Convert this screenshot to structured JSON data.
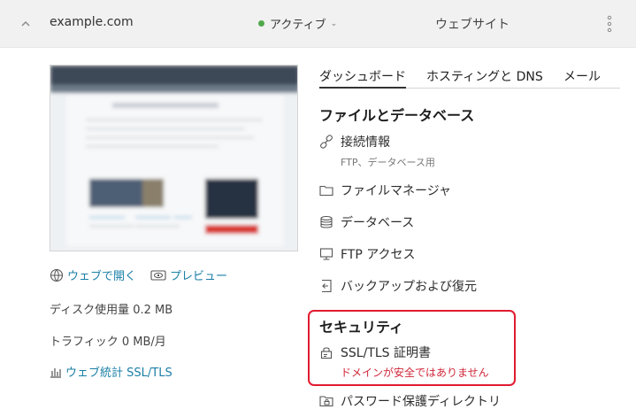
{
  "header": {
    "domain": "example.com",
    "status": "アクティブ",
    "site_label": "ウェブサイト"
  },
  "left": {
    "open_web": "ウェブで開く",
    "preview": "プレビュー",
    "disk_usage": "ディスク使用量 0.2 MB",
    "traffic": "トラフィック 0 MB/月",
    "web_stats": "ウェブ統計 SSL/TLS"
  },
  "tabs": [
    "ダッシュボード",
    "ホスティングと DNS",
    "メール"
  ],
  "files_db": {
    "title": "ファイルとデータベース",
    "connection": "接続情報",
    "connection_sub": "FTP、データベース用",
    "file_manager": "ファイルマネージャ",
    "database": "データベース",
    "ftp": "FTP アクセス",
    "backup": "バックアップおよび復元"
  },
  "security": {
    "title": "セキュリティ",
    "ssl": "SSL/TLS 証明書",
    "warning": "ドメインが安全ではありません",
    "password_dirs": "パスワード保護ディレクトリ"
  },
  "colors": {
    "link": "#1a7fa6",
    "active_dot": "#4fa94a",
    "warning": "#d0283a",
    "highlight": "#e01b30"
  }
}
